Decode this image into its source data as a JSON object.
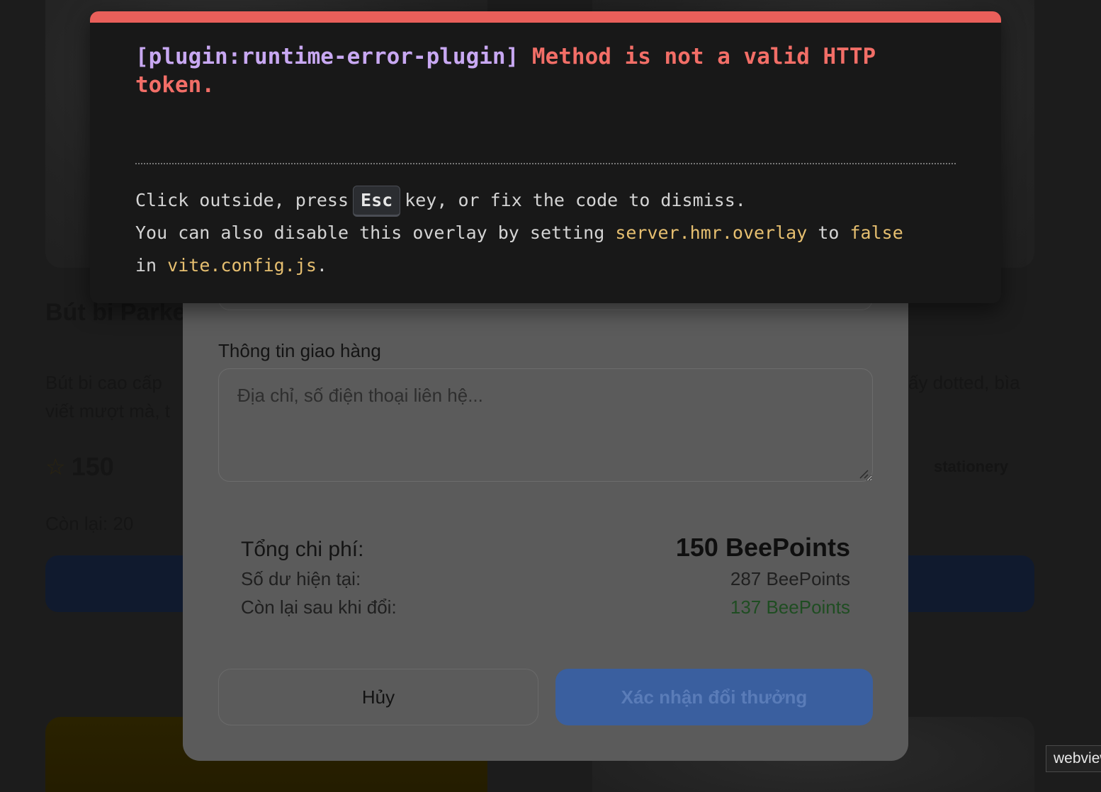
{
  "background": {
    "product_title": "Bút bi Parker",
    "description_left": "Bút bi cao cấp viết mượt mà, t",
    "description_right": "ấy dotted, bìa",
    "points_value": "150",
    "category_tag": "stationery",
    "stock_text": "Còn lại: 20"
  },
  "modal": {
    "shipping_label": "Thông tin giao hàng",
    "shipping_placeholder": "Địa chỉ, số điện thoại liên hệ...",
    "total_cost_label": "Tổng chi phí:",
    "total_cost_value": "150 BeePoints",
    "current_balance_label": "Số dư hiện tại:",
    "current_balance_value": "287 BeePoints",
    "remaining_label": "Còn lại sau khi đổi:",
    "remaining_value": "137 BeePoints",
    "cancel_label": "Hủy",
    "confirm_label": "Xác nhận đổi thưởng"
  },
  "error_overlay": {
    "plugin": "[plugin:runtime-error-plugin]",
    "message": "Method is not a valid HTTP token.",
    "tip_prefix": "Click outside, press",
    "tip_key": "Esc",
    "tip_suffix": "key, or fix the code to dismiss.",
    "tip2_prefix": "You can also disable this overlay by setting",
    "tip2_setting": "server.hmr.overlay",
    "tip2_to": "to",
    "tip2_value": "false",
    "tip3_in": "in",
    "tip3_file": "vite.config.js",
    "tip3_end": "."
  },
  "webview_badge": "webview",
  "colors": {
    "error_red": "#e95f5a",
    "plugin_purple": "#c8a8f2",
    "code_yellow": "#e6bf70",
    "confirm_blue": "#3a5f9f",
    "remaining_green": "#1f4d22"
  }
}
